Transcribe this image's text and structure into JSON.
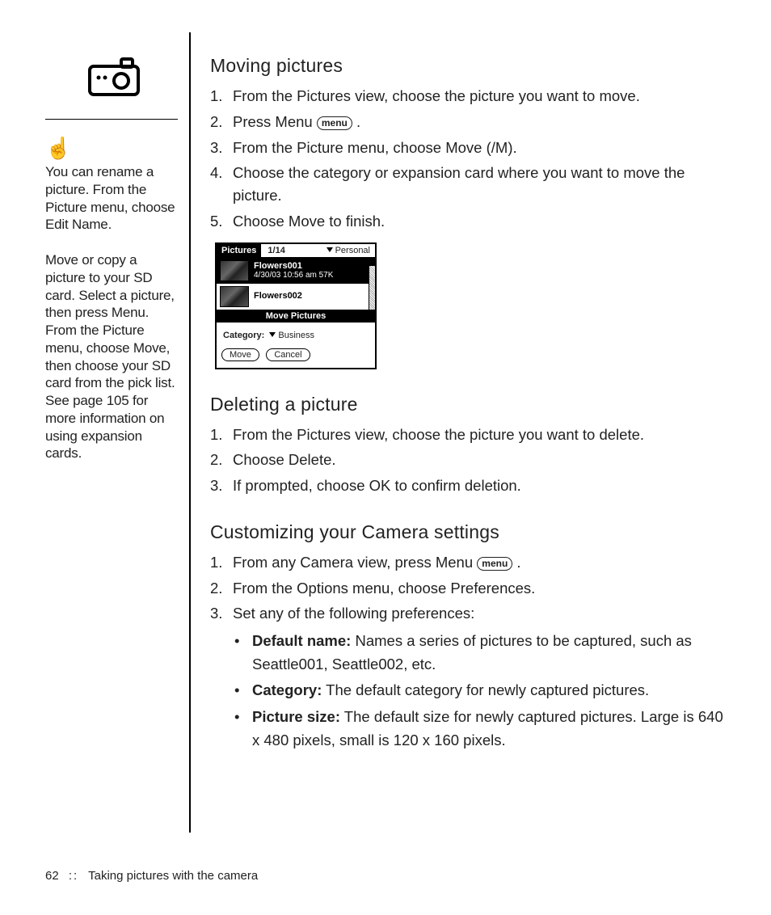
{
  "sidebar": {
    "tip1": "You can rename a picture. From the Picture menu, choose Edit Name.",
    "tip2": "Move or copy a picture to your SD card. Select a picture, then press Menu. From the Picture menu, choose Move, then choose your SD card from the pick list. See page 105 for more information on using expansion cards."
  },
  "menu_key_label": "menu",
  "sections": {
    "moving": {
      "heading": "Moving pictures",
      "steps": [
        "From the Pictures view, choose the picture you want to move.",
        "Press Menu ",
        "From the Picture menu, choose Move (/M).",
        "Choose the category or expansion card where you want to move the picture.",
        "Choose Move to finish."
      ]
    },
    "deleting": {
      "heading": "Deleting a picture",
      "steps": [
        "From the Pictures view, choose the picture you want to delete.",
        "Choose Delete.",
        "If prompted, choose OK to confirm deletion."
      ]
    },
    "custom": {
      "heading": "Customizing your Camera settings",
      "steps": [
        "From any Camera view, press Menu ",
        "From the Options menu, choose Preferences.",
        "Set any of the following preferences:"
      ],
      "bullets": [
        {
          "label": "Default name:",
          "text": " Names a series of pictures to be captured, such as Seattle001, Seattle002, etc."
        },
        {
          "label": "Category:",
          "text": " The default category for newly captured pictures."
        },
        {
          "label": "Picture size:",
          "text": " The default size for newly captured pictures. Large is 640 x 480 pixels, small is 120 x 160 pixels."
        }
      ]
    }
  },
  "screenshot": {
    "title": "Pictures",
    "count": "1/14",
    "category": "Personal",
    "row1_name": "Flowers001",
    "row1_date": "4/30/03 10:56 am 57K",
    "row2_name": "Flowers002",
    "dialog_title": "Move Pictures",
    "dialog_category_label": "Category:",
    "dialog_category_value": "Business",
    "btn_move": "Move",
    "btn_cancel": "Cancel"
  },
  "footer": {
    "page": "62",
    "sep": "::",
    "chapter": "Taking pictures with the camera"
  }
}
